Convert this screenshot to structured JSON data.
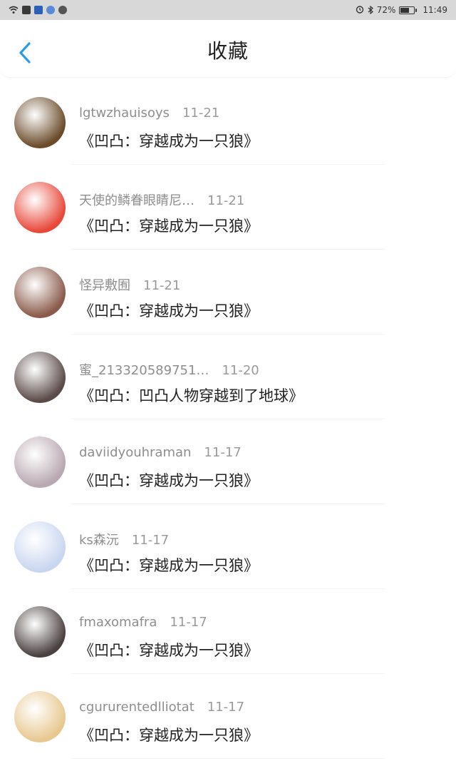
{
  "status_bar": {
    "battery_percent": "72%",
    "time": "11:49",
    "battery_level": 0.72,
    "icons": [
      "wifi-icon",
      "app-icon-1",
      "app-icon-2",
      "app-icon-3",
      "wechat-icon",
      "alarm-icon",
      "bluetooth-icon",
      "battery-icon"
    ]
  },
  "header": {
    "title": "收藏",
    "back_icon": "chevron-left-icon",
    "accent_color": "#2b9ce8"
  },
  "favorites": [
    {
      "user": "lgtwzhauisoys",
      "time": "11-21",
      "book": "《凹凸：穿越成为一只狼》",
      "avatar_color": "#6b4b2a"
    },
    {
      "user": "天使的鳞眷眼睛尼…",
      "time": "11-21",
      "book": "《凹凸：穿越成为一只狼》",
      "avatar_color": "#e8483a"
    },
    {
      "user": "怪异敷囿",
      "time": "11-21",
      "book": "《凹凸：穿越成为一只狼》",
      "avatar_color": "#8a5a4a"
    },
    {
      "user": "蜜_213320589751…",
      "time": "11-20",
      "book": "《凹凸：凹凸人物穿越到了地球》",
      "avatar_color": "#5a4a48"
    },
    {
      "user": "daviidyouhraman",
      "time": "11-17",
      "book": "《凹凸：穿越成为一只狼》",
      "avatar_color": "#b8a8b0"
    },
    {
      "user": "ks森沅",
      "time": "11-17",
      "book": "《凹凸：穿越成为一只狼》",
      "avatar_color": "#c9d6f0"
    },
    {
      "user": "fmaxomafra",
      "time": "11-17",
      "book": "《凹凸：穿越成为一只狼》",
      "avatar_color": "#4a4040"
    },
    {
      "user": "cgururentedlliotat",
      "time": "11-17",
      "book": "《凹凸：穿越成为一只狼》",
      "avatar_color": "#e8c890"
    }
  ]
}
